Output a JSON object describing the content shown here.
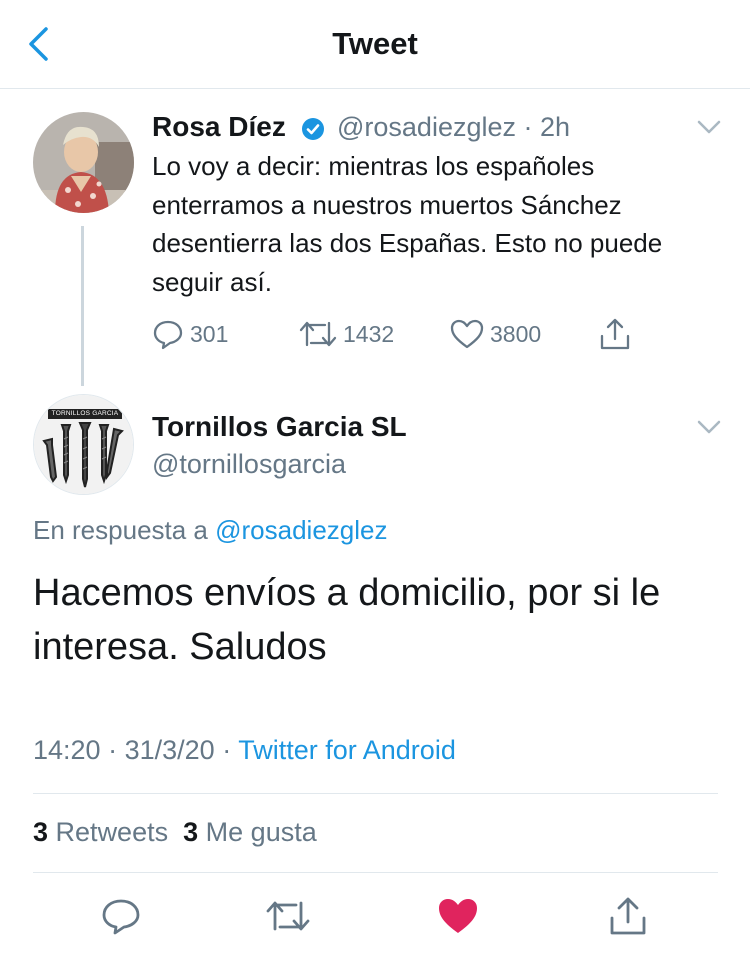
{
  "header": {
    "title": "Tweet"
  },
  "parent_tweet": {
    "name": "Rosa Díez",
    "handle": "@rosadiezglez",
    "separator": "·",
    "time": "2h",
    "text": "Lo voy a decir: mientras los españoles enterramos a nuestros muertos Sánchez desentierra las dos Españas. Esto no puede seguir así.",
    "replies": "301",
    "retweets": "1432",
    "likes": "3800"
  },
  "main_tweet": {
    "name": "Tornillos Garcia SL",
    "handle": "@tornillosgarcia",
    "avatar_label": "TORNILLOS GARCIA",
    "reply_prefix": "En respuesta a",
    "reply_handle": "@rosadiezglez",
    "text": "Hacemos envíos a domicilio, por si le interesa. Saludos",
    "time": "14:20",
    "date": "31/3/20",
    "separator": "·",
    "client": "Twitter for Android",
    "retweet_count": "3",
    "retweet_label": "Retweets",
    "like_count": "3",
    "like_label": "Me gusta"
  },
  "colors": {
    "accent": "#1b95e0",
    "like": "#e0245e",
    "muted": "#657786",
    "border": "#e1e8ed"
  },
  "icons": {
    "back": "chevron-left-icon",
    "verified": "verified-badge-icon",
    "more": "chevron-down-icon",
    "reply": "reply-icon",
    "retweet": "retweet-icon",
    "like": "heart-icon",
    "share": "share-icon"
  }
}
